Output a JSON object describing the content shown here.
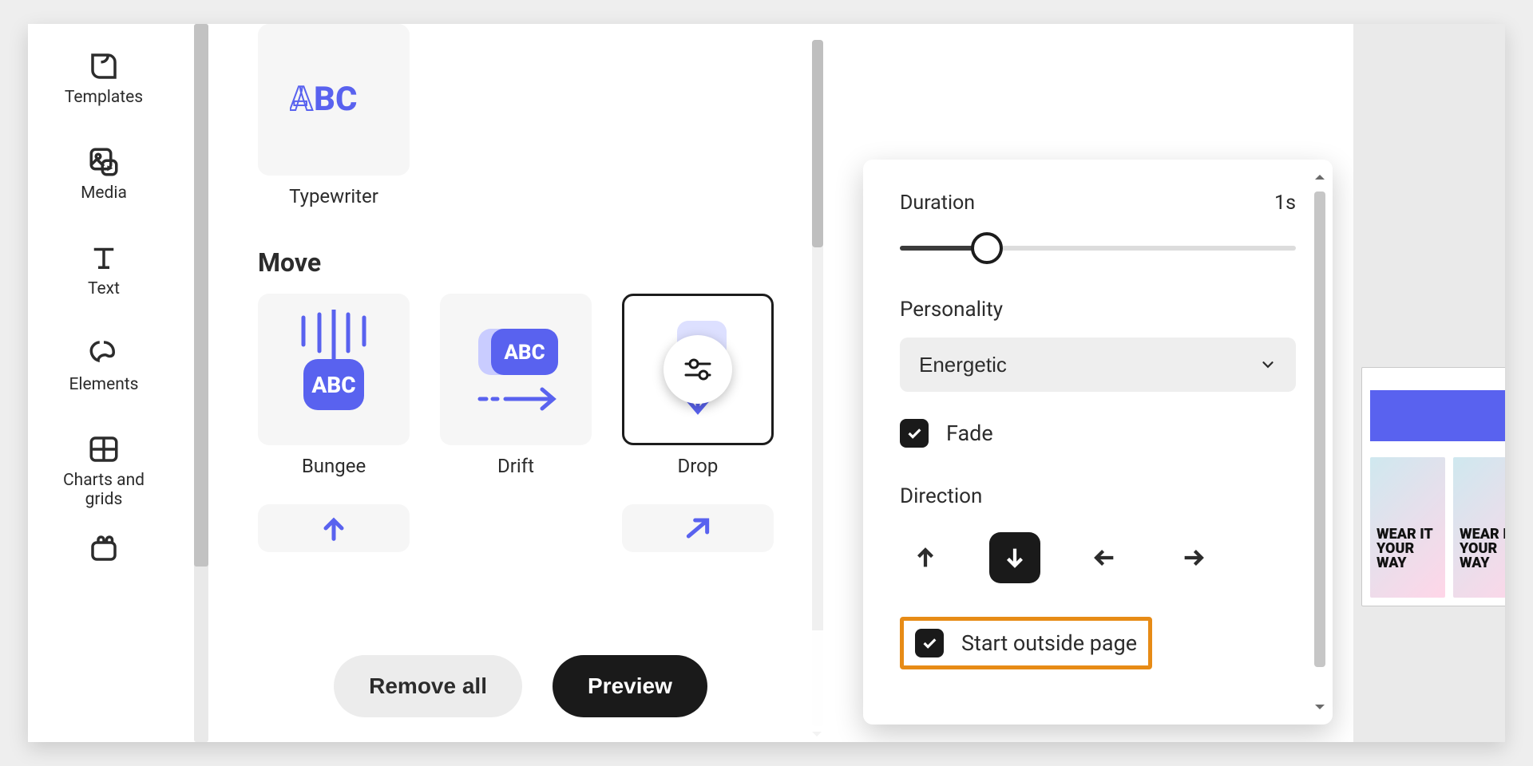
{
  "rail": {
    "templates": "Templates",
    "media": "Media",
    "text": "Text",
    "elements": "Elements",
    "charts": "Charts and grids"
  },
  "anim": {
    "typewriter": "Typewriter",
    "move_section": "Move",
    "bungee": "Bungee",
    "drift": "Drift",
    "drop": "Drop"
  },
  "footer": {
    "remove_all": "Remove all",
    "preview": "Preview"
  },
  "popover": {
    "duration_label": "Duration",
    "duration_value": "1s",
    "duration_fraction": 0.22,
    "personality_label": "Personality",
    "personality_value": "Energetic",
    "fade_label": "Fade",
    "direction_label": "Direction",
    "start_outside_label": "Start outside page"
  },
  "canvas": {
    "tagline": "WEAR IT YOUR WAY"
  }
}
